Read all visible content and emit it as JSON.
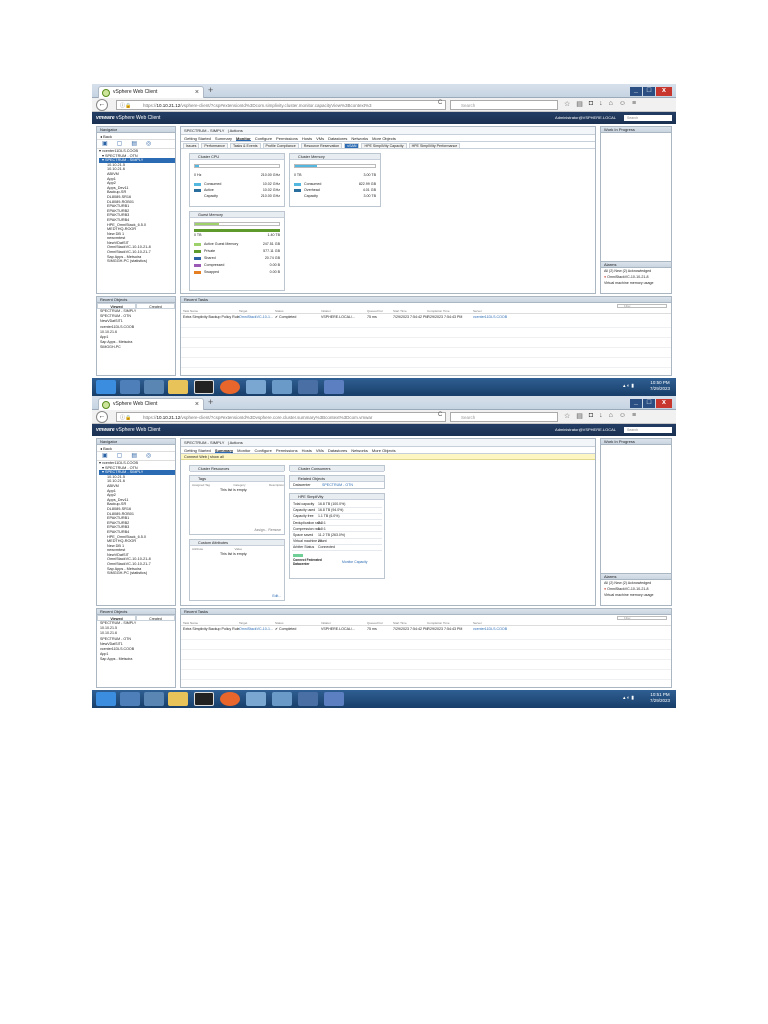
{
  "colors": {
    "accent": "#2b6bb3",
    "header": "#1b3152",
    "taskbar": "#183e69",
    "bar": "#54b7e0"
  },
  "browser": {
    "tab_title": "vSphere Web Client",
    "url_host": "10.10.21.12",
    "url1": "/vsphere-client/?csp#extensionId%3Dcom.simplivity.cluster.monitor.capacityView%3Bcontext%3",
    "url2": "/vsphere-client/?csp#extensionId%3Dvsphere.core.cluster.summary%3Bcontext%3Dcom.vmwar",
    "search_placeholder": "Search"
  },
  "vsphere": {
    "brand": "vmware",
    "product": "vSphere Web Client",
    "user": "Administrator@VSPHERE.LOCAL",
    "help": "Help",
    "search_placeholder": "Search"
  },
  "navigator": {
    "title": "Navigator",
    "back": "Back",
    "tree": [
      "vcenter11DLS.COOB",
      "SPECTRUM - OTN",
      "SPECTRUM - SIMPLY",
      "10.10.21.5",
      "10.10.21.6",
      "ABIVM",
      "App1",
      "App2",
      "Apps_Dev11",
      "Backup-SR",
      "DL8089-SR16",
      "DL8089-ROB01",
      "EPAKTURB1",
      "EPAKTURB2",
      "EPAKTURB3",
      "EPAKTURB4",
      "HPE_OmniStack_6.5.0",
      "MEDTHQ-ROOR",
      "New DB 1",
      "newvmtest",
      "NewVDatSIT",
      "OmniStackVC-10-10-21-8",
      "OmniStackVC-10-10-21-7",
      "Sap Apps - Metsoira",
      "SIMGGH-PC (statistics)"
    ],
    "selected": 2
  },
  "screens": [
    {
      "object": "SPECTRUM - SIMPLY",
      "actions": "Actions",
      "main_tabs": [
        "Getting Started",
        "Summary",
        "Monitor",
        "Configure",
        "Permissions",
        "Hosts",
        "VMs",
        "Datastores",
        "Networks",
        "More Objects"
      ],
      "active_main": 2,
      "sub_tabs": [
        "Issues",
        "Performance",
        "Tasks & Events",
        "Profile Compliance",
        "Resource Reservation",
        "vSAN",
        "HPE SimpliVity Capacity",
        "HPE SimpliVity Performance"
      ],
      "active_sub": 5,
      "cpu": {
        "title": "Cluster CPU",
        "min": "0 Hz",
        "max": "210.00 GHz",
        "rows": [
          [
            "Consumed",
            "10.02 GHz"
          ],
          [
            "Active",
            "10.02 GHz"
          ],
          [
            "Capacity",
            "210.00 GHz"
          ]
        ],
        "fill": 0.05
      },
      "memory": {
        "title": "Cluster Memory",
        "min": "0 TB",
        "max": "3.00 TB",
        "rows": [
          [
            "Consumed",
            "822.99 GB"
          ],
          [
            "Overhead",
            "4.01 GB"
          ],
          [
            "Capacity",
            "3.00 TB"
          ]
        ],
        "fill": 0.27
      },
      "guest": {
        "title": "Guest Memory",
        "min": "0 TB",
        "max": "1.40 TB",
        "rows": [
          [
            "Active Guest Memory",
            "247.51 GB"
          ],
          [
            "Private",
            "577.11 GB"
          ],
          [
            "Shared",
            "20.74 GB"
          ],
          [
            "Compressed",
            "0.00 B"
          ],
          [
            "Swapped",
            "0.00 B"
          ]
        ]
      }
    },
    {
      "object": "SPECTRUM - SIMPLY",
      "actions": "Actions",
      "main_tabs": [
        "Getting Started",
        "Summary",
        "Monitor",
        "Configure",
        "Permissions",
        "Hosts",
        "VMs",
        "Datastores",
        "Networks",
        "More Objects"
      ],
      "active_main": 1,
      "banner": "Connect Web | show all",
      "resources_title": "Cluster Resources",
      "consumers_title": "Cluster Consumers",
      "tags": {
        "title": "Tags",
        "cols": [
          "Assigned Tag",
          "Category",
          "Description"
        ],
        "empty": "This list is empty.",
        "footer": "Assign... Remove"
      },
      "attrs": {
        "title": "Custom Attributes",
        "cols": [
          "Attribute",
          "Value"
        ],
        "empty": "This list is empty.",
        "edit": "Edit..."
      },
      "related": {
        "title": "Related Objects",
        "k": "Datacenter",
        "v": "SPECTRUM - OTN"
      },
      "simplivity": {
        "title": "HPE SimpliVity",
        "rows": [
          [
            "Total capacity",
            "16.8 TB (100.0%)"
          ],
          [
            "Capacity used",
            "16.8 TB (94.0%)"
          ],
          [
            "Capacity free",
            "1.1 TB (6.0%)"
          ],
          [
            "Deduplication ratio",
            "2.3:1"
          ],
          [
            "Compression ratio",
            "1.0:1"
          ],
          [
            "Space saved",
            "11.2 TB (263.0%)"
          ],
          [
            "Virtual machine count",
            "20"
          ],
          [
            "Arbiter Status",
            "Connected"
          ]
        ],
        "footer_k": "Connect Federated Datacenter",
        "footer_v": "Monitor Capacity"
      }
    }
  ],
  "right": {
    "wip": "Work In Progress",
    "alarms": "Alarms",
    "alarm_tabs": "All (2) New (2) Acknowledged",
    "alarm1": "OmniStackVC-10-10-21-8",
    "alarm2": "Virtual machine memory usage"
  },
  "recent_objects": {
    "title": "Recent Objects",
    "tabs": [
      "Viewed",
      "Created"
    ],
    "items1": [
      "SPECTRUM - SIMPLY",
      "SPECTRUM - OTN",
      "NewVDatSIT1",
      "vcenter11DLS.COOB",
      "10.10.21.6",
      "App1",
      "Sap Apps - Metsoira",
      "SIMGGH-PC"
    ],
    "items2": [
      "SPECTRUM - SIMPLY",
      "10.10.21.5",
      "10.10.21.6",
      "SPECTRUM - OTN",
      "NewVDatSIT1",
      "vcenter11DLS.COOB",
      "App1",
      "Sap Apps - Metsoira"
    ]
  },
  "tasks": {
    "title": "Recent Tasks",
    "filter": "Filter",
    "cols": [
      "Task Name",
      "Target",
      "Status",
      "Initiator",
      "Queued For",
      "Start Time",
      "Completion Time",
      "Server"
    ],
    "row": [
      "Extra Simplivity Backup Policy Rule",
      "OmniStackVC-10-1...",
      "Completed",
      "VSPHERE.LOCAL\\...",
      "75 ms",
      "7/29/2023 7:54:42 PM",
      "7/29/2023 7:54:43 PM",
      "vcenter11DLS.COOB"
    ]
  },
  "clock": [
    {
      "time": "10:50 PM",
      "date": "7/29/2023"
    },
    {
      "time": "10:51 PM",
      "date": "7/29/2023"
    }
  ]
}
